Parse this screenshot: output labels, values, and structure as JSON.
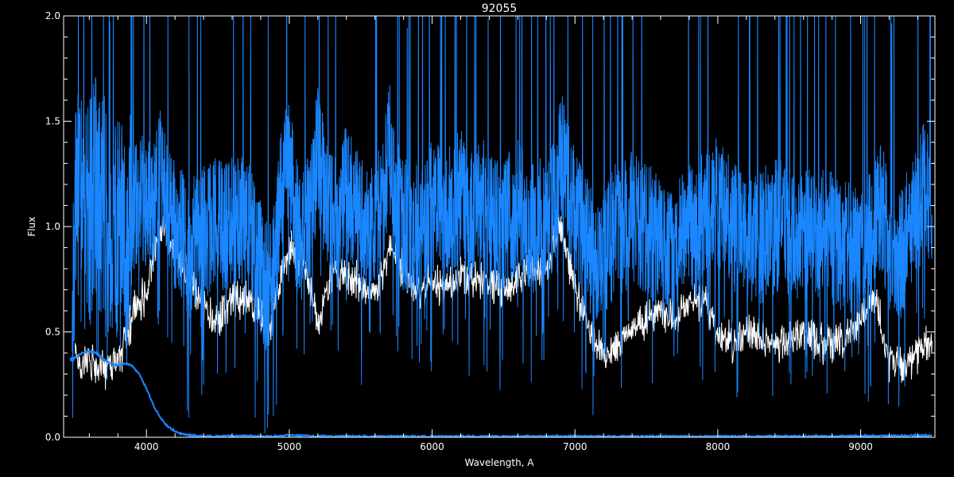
{
  "chart_data": {
    "type": "line",
    "title": "92055",
    "xlabel": "Wavelength, A",
    "ylabel": "Flux",
    "xlim": [
      3420,
      9520
    ],
    "ylim": [
      0.0,
      2.0
    ],
    "x_ticks": [
      4000,
      5000,
      6000,
      7000,
      8000,
      9000
    ],
    "x_tick_labels": [
      "4000",
      "5000",
      "6000",
      "7000",
      "8000",
      "9000"
    ],
    "y_ticks": [
      0.0,
      0.5,
      1.0,
      1.5,
      2.0
    ],
    "y_tick_labels": [
      "0.0",
      "0.5",
      "1.0",
      "1.5",
      "2.0"
    ],
    "grid": false,
    "background_color": "#000000",
    "axis_color": "#ffffff",
    "series": [
      {
        "color": "#ffffff",
        "style": "lower envelope (white)",
        "x": [
          3500,
          3600,
          3700,
          3800,
          3900,
          4000,
          4100,
          4200,
          4300,
          4400,
          4500,
          4600,
          4700,
          4800,
          4850,
          4900,
          5000,
          5100,
          5200,
          5300,
          5400,
          5500,
          5600,
          5700,
          5800,
          5900,
          6000,
          6100,
          6200,
          6300,
          6400,
          6500,
          6600,
          6700,
          6800,
          6900,
          7000,
          7100,
          7200,
          7300,
          7400,
          7500,
          7600,
          7700,
          7800,
          7900,
          8000,
          8100,
          8200,
          8300,
          8400,
          8500,
          8600,
          8700,
          8800,
          8900,
          9000,
          9100,
          9200,
          9300,
          9400,
          9500
        ],
        "y": [
          0.4,
          0.42,
          0.38,
          0.4,
          0.62,
          0.75,
          1.05,
          0.95,
          0.8,
          0.7,
          0.6,
          0.72,
          0.7,
          0.65,
          0.55,
          0.7,
          0.95,
          0.9,
          0.6,
          0.85,
          0.8,
          0.78,
          0.7,
          0.95,
          0.85,
          0.72,
          0.8,
          0.75,
          0.82,
          0.8,
          0.78,
          0.76,
          0.8,
          0.85,
          0.86,
          1.05,
          0.75,
          0.55,
          0.45,
          0.5,
          0.55,
          0.6,
          0.65,
          0.6,
          0.7,
          0.7,
          0.55,
          0.5,
          0.55,
          0.52,
          0.5,
          0.5,
          0.55,
          0.5,
          0.5,
          0.52,
          0.6,
          0.72,
          0.4,
          0.38,
          0.45,
          0.5
        ]
      },
      {
        "color": "#1a86ff",
        "style": "observed flux, dense absorption spectrum (blue)",
        "x": [
          3480,
          3500,
          3550,
          3600,
          3650,
          3700,
          3750,
          3800,
          3850,
          3900,
          3950,
          4000,
          4050,
          4100,
          4150,
          4200,
          4250,
          4300,
          4350,
          4400,
          4450,
          4500,
          4550,
          4600,
          4650,
          4700,
          4750,
          4800,
          4850,
          4900,
          4950,
          5000,
          5050,
          5100,
          5150,
          5200,
          5250,
          5300,
          5350,
          5400,
          5450,
          5500,
          5550,
          5600,
          5650,
          5700,
          5750,
          5800,
          5850,
          5900,
          5950,
          6000,
          6050,
          6100,
          6150,
          6200,
          6250,
          6300,
          6350,
          6400,
          6450,
          6500,
          6550,
          6600,
          6650,
          6700,
          6750,
          6800,
          6850,
          6900,
          6950,
          7000,
          7050,
          7100,
          7150,
          7200,
          7250,
          7300,
          7350,
          7400,
          7450,
          7500,
          7550,
          7600,
          7650,
          7700,
          7750,
          7800,
          7850,
          7900,
          7950,
          8000,
          8050,
          8100,
          8150,
          8200,
          8250,
          8300,
          8350,
          8400,
          8450,
          8500,
          8550,
          8600,
          8650,
          8700,
          8750,
          8800,
          8850,
          8900,
          8950,
          9000,
          9050,
          9100,
          9150,
          9200,
          9250,
          9300,
          9350,
          9400,
          9450,
          9500
        ],
        "y": [
          0.37,
          1.1,
          1.05,
          1.05,
          1.2,
          1.1,
          1.0,
          0.98,
          0.9,
          1.05,
          1.2,
          1.1,
          1.1,
          1.25,
          1.1,
          1.0,
          0.95,
          0.88,
          0.95,
          1.0,
          0.98,
          1.05,
          1.0,
          1.05,
          1.02,
          1.05,
          0.9,
          0.8,
          0.7,
          0.85,
          1.2,
          1.3,
          1.0,
          0.95,
          1.1,
          1.35,
          1.15,
          1.05,
          1.0,
          1.2,
          1.1,
          1.0,
          1.0,
          1.05,
          1.05,
          1.4,
          1.1,
          1.0,
          1.0,
          1.0,
          1.05,
          1.1,
          1.1,
          1.05,
          1.1,
          1.15,
          1.05,
          1.05,
          1.1,
          1.05,
          1.0,
          1.0,
          1.05,
          1.1,
          1.05,
          1.0,
          1.0,
          1.05,
          1.1,
          1.35,
          1.2,
          1.05,
          0.95,
          0.9,
          0.85,
          0.9,
          0.95,
          1.0,
          1.0,
          1.05,
          1.0,
          1.0,
          0.95,
          0.9,
          0.85,
          0.85,
          0.95,
          0.98,
          0.95,
          1.05,
          1.1,
          1.1,
          1.05,
          1.0,
          0.98,
          0.95,
          0.95,
          0.95,
          0.98,
          1.0,
          1.0,
          0.95,
          0.95,
          0.95,
          0.95,
          0.95,
          0.98,
          0.95,
          0.9,
          0.92,
          0.9,
          0.9,
          0.95,
          1.0,
          1.1,
          0.9,
          0.85,
          0.9,
          1.0,
          1.1,
          1.2,
          1.1
        ]
      },
      {
        "color": "#1a86ff",
        "style": "model / continuum curve (blue)",
        "x": [
          3480,
          3550,
          3600,
          3650,
          3700,
          3750,
          3800,
          3850,
          3900,
          3950,
          4000,
          4050,
          4100,
          4150,
          4200,
          4250,
          4300,
          4350,
          4400,
          4500,
          4600,
          4700,
          4800,
          4900,
          5000,
          5200,
          5500,
          6000,
          6500,
          7000,
          7500,
          8000,
          8500,
          9000,
          9500
        ],
        "y": [
          0.37,
          0.4,
          0.41,
          0.4,
          0.37,
          0.35,
          0.34,
          0.35,
          0.34,
          0.3,
          0.23,
          0.15,
          0.09,
          0.05,
          0.03,
          0.015,
          0.01,
          0.007,
          0.005,
          0.005,
          0.006,
          0.008,
          0.005,
          0.006,
          0.01,
          0.005,
          0.004,
          0.004,
          0.004,
          0.004,
          0.004,
          0.004,
          0.005,
          0.006,
          0.008
        ]
      }
    ]
  }
}
